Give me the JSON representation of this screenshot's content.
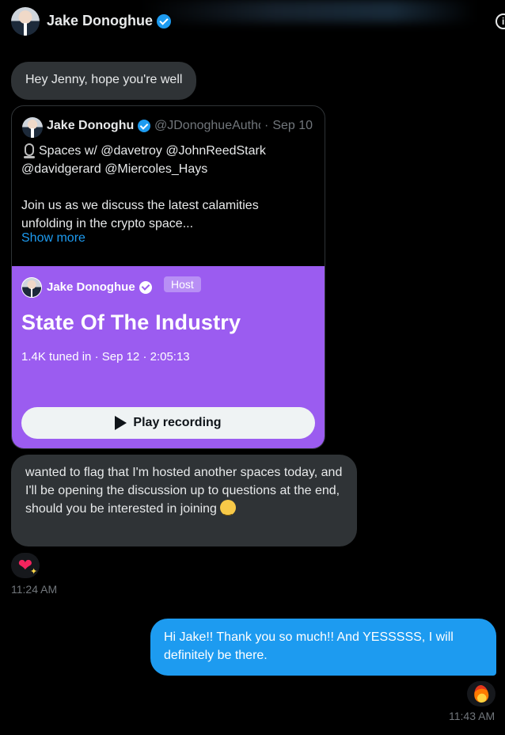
{
  "header": {
    "contact_name": "Jake Donoghue",
    "info_icon": "i"
  },
  "messages": [
    {
      "id": "m1",
      "direction": "incoming",
      "text": "Hey Jenny, hope you're well"
    },
    {
      "id": "m2",
      "direction": "incoming",
      "type": "tweet-card"
    },
    {
      "id": "m3",
      "direction": "incoming",
      "text": "wanted to flag that I'm hosted another spaces today, and I'll be opening the discussion up to questions at the end, should you be interested in joining",
      "emoji": "slightly-smiling-face"
    },
    {
      "id": "m4",
      "direction": "outgoing",
      "text": "Hi Jake!! Thank you so much!! And YESSSSS, I will definitely be there."
    }
  ],
  "tweet": {
    "author_name": "Jake Donoghue",
    "handle": "@JDonoghueAuthor",
    "separator": "·",
    "date": "Sep 10",
    "line1": "Spaces w/ @davetroy @JohnReedStark",
    "line2": "@davidgerard @Miercoles_Hays",
    "line3": "Join us as we discuss the latest calamities",
    "line4": "unfolding in the crypto space...",
    "show_more": "Show more"
  },
  "space": {
    "host_name": "Jake Donoghue",
    "host_badge": "Host",
    "title": "State Of The Industry",
    "meta": "1.4K tuned in · Sep 12 · 2:05:13",
    "play_label": "Play recording",
    "color": "#9b5cf0"
  },
  "reactions": {
    "incoming": "sparkling-heart",
    "outgoing": "fire"
  },
  "timestamps": {
    "incoming": "11:24 AM",
    "outgoing": "11:43 AM"
  },
  "colors": {
    "background": "#000000",
    "incoming_bubble": "#2f3336",
    "outgoing_bubble": "#1d9bf0",
    "link": "#1d9bf0",
    "muted": "#71767b"
  }
}
